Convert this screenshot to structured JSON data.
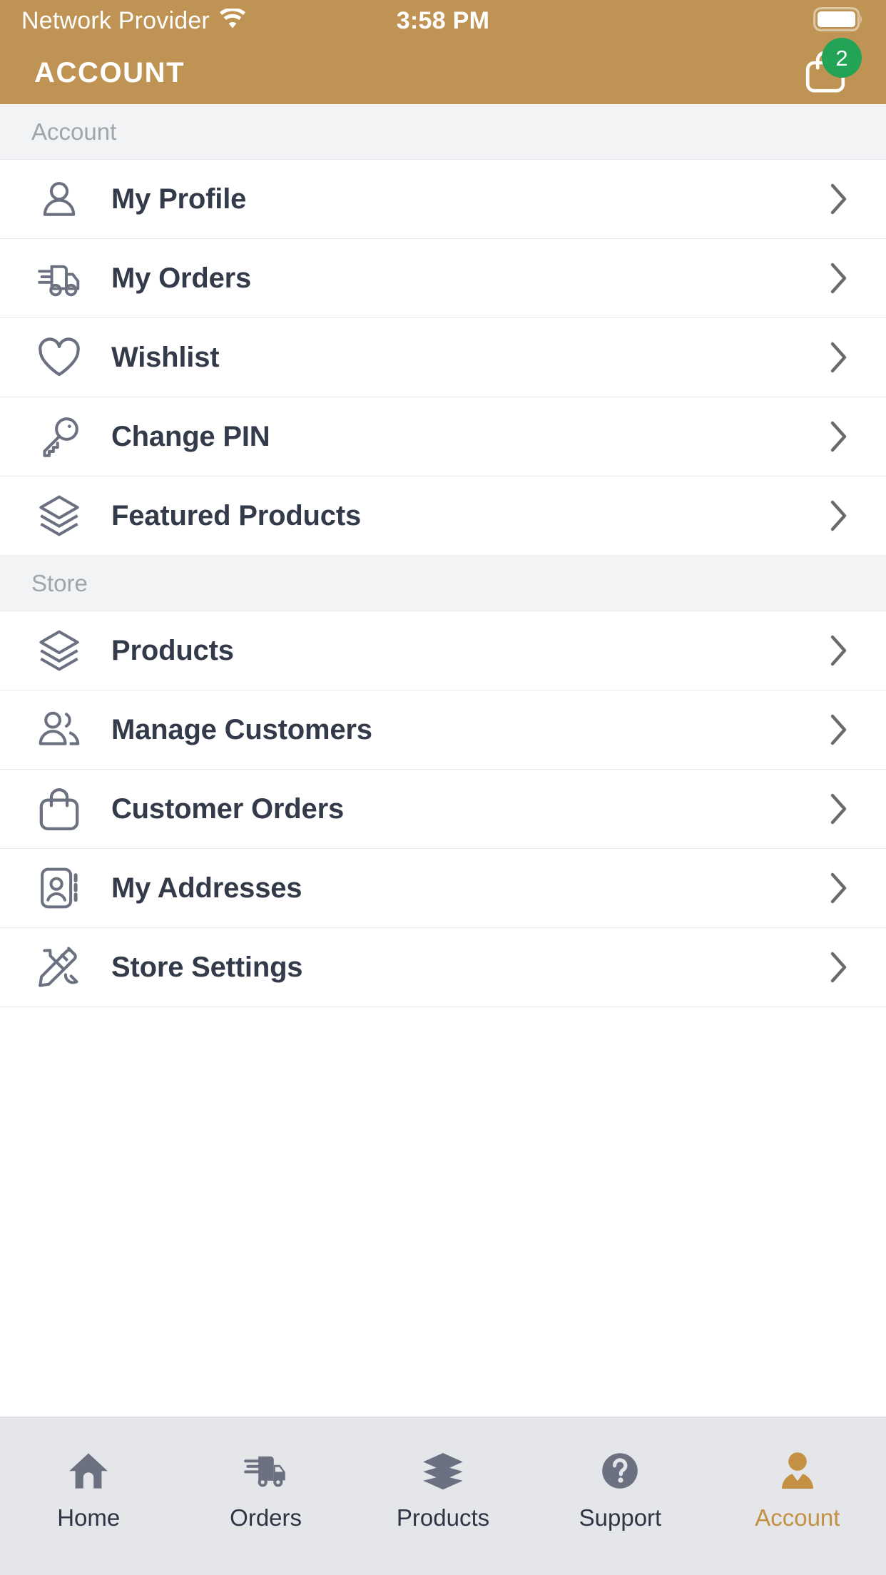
{
  "theme": {
    "brand": "#bf9354",
    "brand_active_tab": "#c49043",
    "badge_green": "#22a356",
    "icon_gray": "#6b7180",
    "label_dark": "#333a4a",
    "section_bg": "#f2f3f5",
    "section_text": "#a0a4ab",
    "tabbar_bg": "#e4e6e9"
  },
  "status_bar": {
    "carrier": "Network Provider",
    "wifi_icon": "wifi-icon",
    "time": "3:58 PM",
    "battery_icon": "battery-full-icon"
  },
  "app_bar": {
    "title": "ACCOUNT",
    "cart_icon": "shopping-bag-icon",
    "cart_badge_count": "2"
  },
  "sections": [
    {
      "header": "Account",
      "items": [
        {
          "label": "My Profile",
          "icon": "user-outline-icon",
          "chevron": "chevron-right-icon"
        },
        {
          "label": "My Orders",
          "icon": "delivery-truck-icon",
          "chevron": "chevron-right-icon"
        },
        {
          "label": "Wishlist",
          "icon": "heart-outline-icon",
          "chevron": "chevron-right-icon"
        },
        {
          "label": "Change PIN",
          "icon": "key-icon",
          "chevron": "chevron-right-icon"
        },
        {
          "label": "Featured Products",
          "icon": "layers-icon",
          "chevron": "chevron-right-icon"
        }
      ]
    },
    {
      "header": "Store",
      "items": [
        {
          "label": "Products",
          "icon": "layers-icon",
          "chevron": "chevron-right-icon"
        },
        {
          "label": "Manage Customers",
          "icon": "users-group-icon",
          "chevron": "chevron-right-icon"
        },
        {
          "label": "Customer Orders",
          "icon": "shopping-bag-icon",
          "chevron": "chevron-right-icon"
        },
        {
          "label": "My Addresses",
          "icon": "address-book-icon",
          "chevron": "chevron-right-icon"
        },
        {
          "label": "Store Settings",
          "icon": "pencil-tools-icon",
          "chevron": "chevron-right-icon"
        }
      ]
    }
  ],
  "tab_bar": {
    "tabs": [
      {
        "label": "Home",
        "icon": "home-icon",
        "active": false
      },
      {
        "label": "Orders",
        "icon": "delivery-truck-icon",
        "active": false
      },
      {
        "label": "Products",
        "icon": "layers-icon",
        "active": false
      },
      {
        "label": "Support",
        "icon": "question-circle-icon",
        "active": false
      },
      {
        "label": "Account",
        "icon": "person-icon",
        "active": true
      }
    ]
  }
}
